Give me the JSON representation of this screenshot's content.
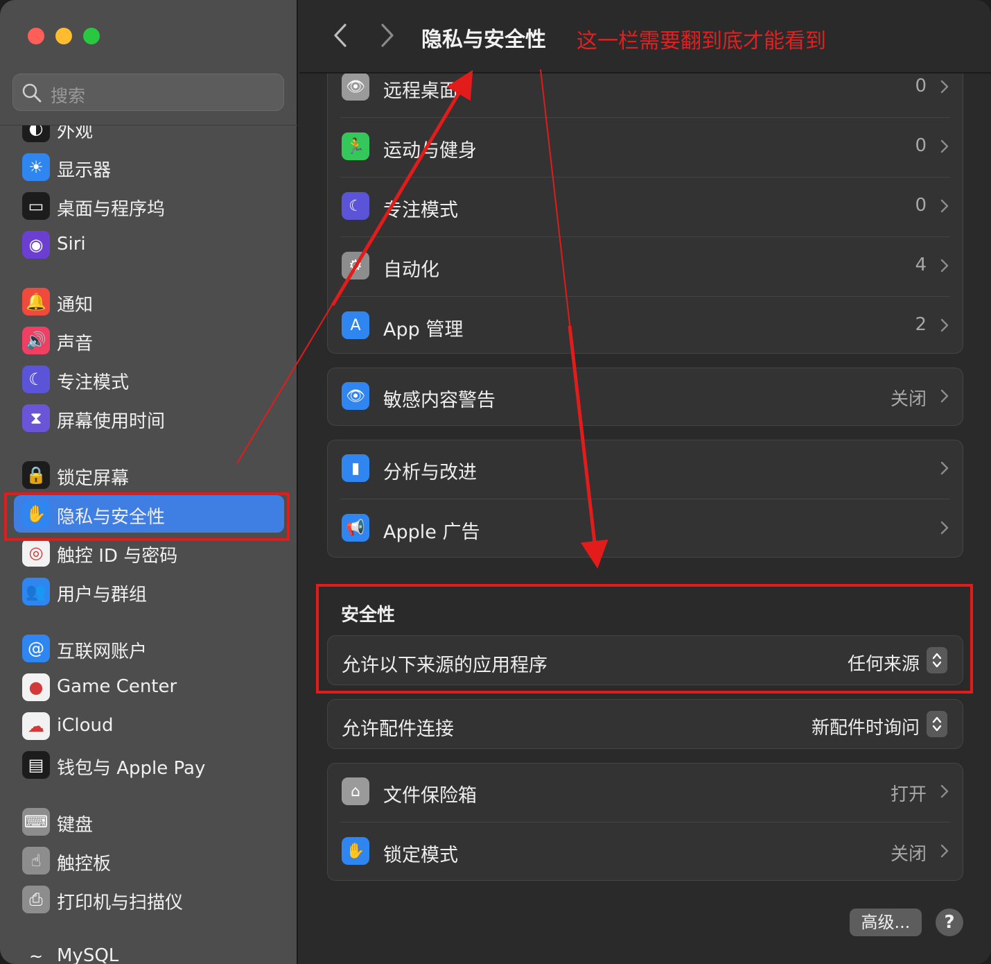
{
  "window": {
    "title": "隐私与安全性"
  },
  "search": {
    "placeholder": "搜索"
  },
  "sidebar": {
    "items": [
      {
        "key": "appearance",
        "label": "外观",
        "icon": "appearance-icon",
        "color": "#1c1c1c",
        "glyph": "◐"
      },
      {
        "key": "displays",
        "label": "显示器",
        "icon": "sun-icon",
        "color": "#2f86f0",
        "glyph": "☀"
      },
      {
        "key": "desktop-dock",
        "label": "桌面与程序坞",
        "icon": "dock-icon",
        "color": "#1c1c1c",
        "glyph": "▭"
      },
      {
        "key": "siri",
        "label": "Siri",
        "icon": "siri-icon",
        "color": "#6b3fd1",
        "glyph": "◉"
      },
      {
        "key": "notifications",
        "label": "通知",
        "icon": "bell-icon",
        "color": "#f0493e",
        "glyph": "🔔"
      },
      {
        "key": "sound",
        "label": "声音",
        "icon": "speaker-icon",
        "color": "#ef3f63",
        "glyph": "🔊"
      },
      {
        "key": "focus",
        "label": "专注模式",
        "icon": "moon-icon",
        "color": "#5b54d9",
        "glyph": "☾"
      },
      {
        "key": "screen-time",
        "label": "屏幕使用时间",
        "icon": "hourglass-icon",
        "color": "#6a55d8",
        "glyph": "⧗"
      },
      {
        "key": "lock-screen",
        "label": "锁定屏幕",
        "icon": "lock-icon",
        "color": "#1c1c1c",
        "glyph": "🔒"
      },
      {
        "key": "privacy",
        "label": "隐私与安全性",
        "icon": "hand-icon",
        "color": "#2f86f0",
        "glyph": "✋"
      },
      {
        "key": "touch-id",
        "label": "触控 ID 与密码",
        "icon": "fingerprint-icon",
        "color": "#f2f2f2",
        "glyph": "◎"
      },
      {
        "key": "users",
        "label": "用户与群组",
        "icon": "users-icon",
        "color": "#2f86f0",
        "glyph": "👥"
      },
      {
        "key": "internet-accounts",
        "label": "互联网账户",
        "icon": "at-icon",
        "color": "#2f86f0",
        "glyph": "@"
      },
      {
        "key": "game-center",
        "label": "Game Center",
        "icon": "game-center-icon",
        "color": "#f2f2f2",
        "glyph": "●"
      },
      {
        "key": "icloud",
        "label": "iCloud",
        "icon": "cloud-icon",
        "color": "#f2f2f2",
        "glyph": "☁"
      },
      {
        "key": "wallet",
        "label": "钱包与 Apple Pay",
        "icon": "wallet-icon",
        "color": "#1c1c1c",
        "glyph": "▤"
      },
      {
        "key": "keyboard",
        "label": "键盘",
        "icon": "keyboard-icon",
        "color": "#8e8d8d",
        "glyph": "⌨"
      },
      {
        "key": "trackpad",
        "label": "触控板",
        "icon": "trackpad-icon",
        "color": "#8e8d8d",
        "glyph": "☝"
      },
      {
        "key": "printers",
        "label": "打印机与扫描仪",
        "icon": "printer-icon",
        "color": "#8e8d8d",
        "glyph": "⎙"
      },
      {
        "key": "mysql",
        "label": "MySQL",
        "icon": "mysql-icon",
        "color": "#4e4d4d",
        "glyph": "~"
      }
    ]
  },
  "annotation": {
    "text": "这一栏需要翻到底才能看到",
    "color": "#e21b1b"
  },
  "main": {
    "group1": [
      {
        "label": "远程桌面",
        "value": "0",
        "icon": "binoculars-icon",
        "color": "#9a9a9a",
        "glyph": "👁"
      },
      {
        "label": "运动与健身",
        "value": "0",
        "icon": "fitness-icon",
        "color": "#34c759",
        "glyph": "🏃"
      },
      {
        "label": "专注模式",
        "value": "0",
        "icon": "moon-icon",
        "color": "#5b54d9",
        "glyph": "☾"
      },
      {
        "label": "自动化",
        "value": "4",
        "icon": "gears-icon",
        "color": "#8e8d8d",
        "glyph": "⚙"
      },
      {
        "label": "App 管理",
        "value": "2",
        "icon": "app-store-icon",
        "color": "#2f86f0",
        "glyph": "A"
      }
    ],
    "group2": [
      {
        "label": "敏感内容警告",
        "value": "关闭",
        "icon": "eye-warning-icon",
        "color": "#2f86f0",
        "glyph": "👁"
      }
    ],
    "group3": [
      {
        "label": "分析与改进",
        "value": "",
        "icon": "chart-bars-icon",
        "color": "#2f86f0",
        "glyph": "▮"
      },
      {
        "label": "Apple 广告",
        "value": "",
        "icon": "megaphone-icon",
        "color": "#2f86f0",
        "glyph": "📢"
      }
    ],
    "security_title": "安全性",
    "allow_apps": {
      "label": "允许以下来源的应用程序",
      "value": "任何来源"
    },
    "allow_accessories": {
      "label": "允许配件连接",
      "value": "新配件时询问"
    },
    "group4": [
      {
        "label": "文件保险箱",
        "value": "打开",
        "icon": "house-lock-icon",
        "color": "#9a9a9a",
        "glyph": "⌂"
      },
      {
        "label": "锁定模式",
        "value": "关闭",
        "icon": "hand-icon",
        "color": "#2f86f0",
        "glyph": "✋"
      }
    ],
    "advanced_label": "高级...",
    "help_label": "?"
  }
}
